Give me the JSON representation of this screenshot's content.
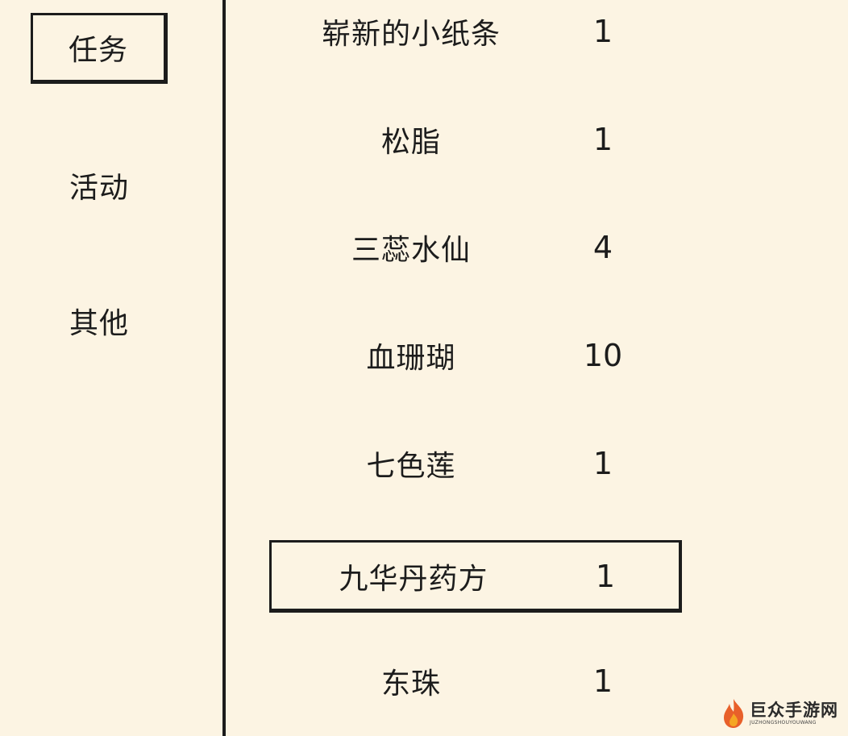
{
  "sidebar": {
    "tabs": [
      {
        "label": "任务",
        "selected": true
      },
      {
        "label": "活动",
        "selected": false
      },
      {
        "label": "其他",
        "selected": false
      }
    ]
  },
  "items": [
    {
      "name": "崭新的小纸条",
      "qty": "1",
      "selected": false
    },
    {
      "name": "松脂",
      "qty": "1",
      "selected": false
    },
    {
      "name": "三蕊水仙",
      "qty": "4",
      "selected": false
    },
    {
      "name": "血珊瑚",
      "qty": "10",
      "selected": false
    },
    {
      "name": "七色莲",
      "qty": "1",
      "selected": false
    },
    {
      "name": "九华丹药方",
      "qty": "1",
      "selected": true
    },
    {
      "name": "东珠",
      "qty": "1",
      "selected": false
    }
  ],
  "watermark": {
    "title": "巨众手游网",
    "subtitle": "JUZHONGSHOUYOUWANG",
    "logo_colors": {
      "outer": "#e8602a",
      "inner": "#f5a623"
    }
  },
  "colors": {
    "background": "#fcf4e3",
    "ink": "#1c1c1c"
  }
}
